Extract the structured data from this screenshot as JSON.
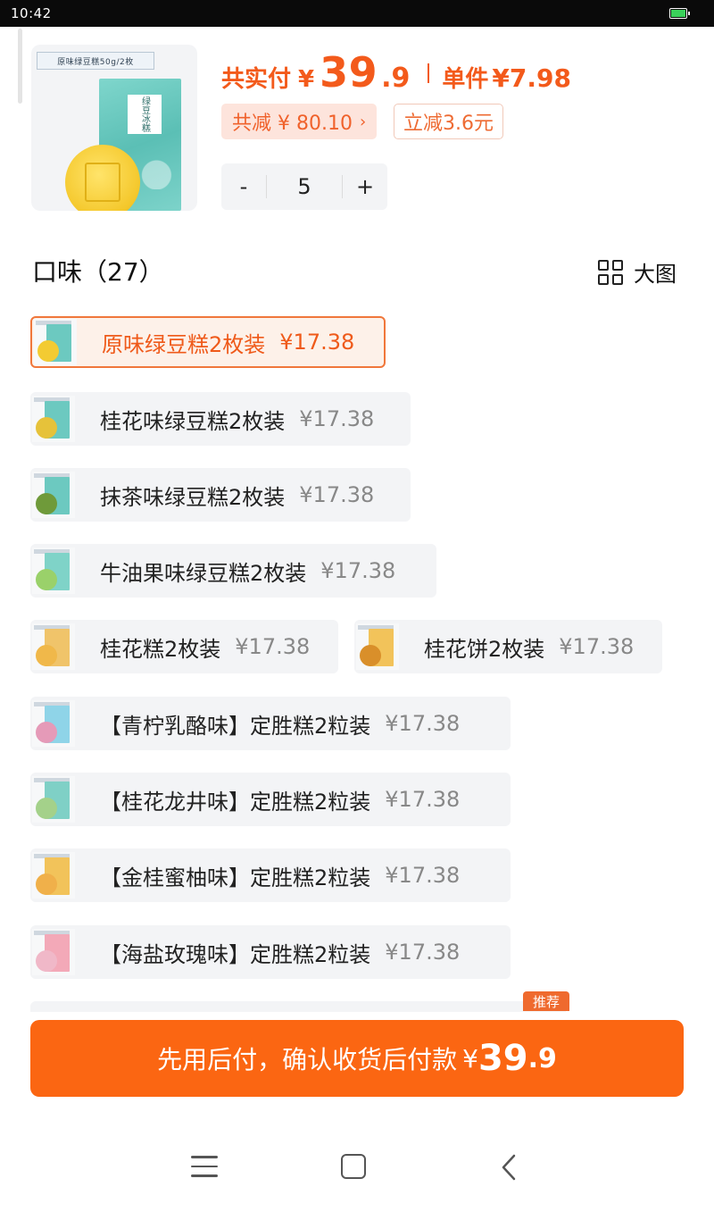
{
  "status_bar": {
    "time": "10:42"
  },
  "product": {
    "package_label": "原味绿豆糕50g/2枚",
    "box_text": "绿豆冰糕"
  },
  "price": {
    "total_label": "共实付",
    "currency": "¥",
    "total_integer": "39",
    "total_decimal": ".9",
    "unit_label": "单件",
    "unit_price": "¥7.98"
  },
  "discounts": {
    "total_reduce": "共减 ¥ 80.10",
    "instant_reduce": "立减3.6元"
  },
  "quantity": {
    "minus": "-",
    "value": "5",
    "plus": "+"
  },
  "flavors": {
    "title": "口味（27）",
    "view_label": "大图",
    "items": [
      {
        "name": "原味绿豆糕2枚装",
        "price": "¥17.38",
        "selected": true,
        "pack_color": "#6cc9c0",
        "cake_color": "#f3cb32"
      },
      {
        "name": "桂花味绿豆糕2枚装",
        "price": "¥17.38",
        "selected": false,
        "pack_color": "#6cc9c0",
        "cake_color": "#e6c23a"
      },
      {
        "name": "抹茶味绿豆糕2枚装",
        "price": "¥17.38",
        "selected": false,
        "pack_color": "#6cc9c0",
        "cake_color": "#6f9a3a"
      },
      {
        "name": "牛油果味绿豆糕2枚装",
        "price": "¥17.38",
        "selected": false,
        "pack_color": "#7fd3c8",
        "cake_color": "#9ad16a"
      },
      {
        "name": "桂花糕2枚装",
        "price": "¥17.38",
        "selected": false,
        "pack_color": "#f0c46a",
        "cake_color": "#f0b84a"
      },
      {
        "name": "桂花饼2枚装",
        "price": "¥17.38",
        "selected": false,
        "pack_color": "#f2c35a",
        "cake_color": "#d98f2a"
      },
      {
        "name": "【青柠乳酪味】定胜糕2粒装",
        "price": "¥17.38",
        "selected": false,
        "pack_color": "#8fd4e8",
        "cake_color": "#e59ab8"
      },
      {
        "name": "【桂花龙井味】定胜糕2粒装",
        "price": "¥17.38",
        "selected": false,
        "pack_color": "#7fd0c6",
        "cake_color": "#a4d18a"
      },
      {
        "name": "【金桂蜜柚味】定胜糕2粒装",
        "price": "¥17.38",
        "selected": false,
        "pack_color": "#f2c35a",
        "cake_color": "#f0b04a"
      },
      {
        "name": "【海盐玫瑰味】定胜糕2粒装",
        "price": "¥17.38",
        "selected": false,
        "pack_color": "#f3a9b8",
        "cake_color": "#f0b8c8"
      }
    ],
    "recommend_badge": "推荐"
  },
  "pay_button": {
    "text": "先用后付，确认收货后付款",
    "currency": "¥",
    "amount_integer": "39",
    "amount_decimal": ".9"
  },
  "colors": {
    "accent": "#fb6612",
    "price_orange": "#f35a1b"
  }
}
